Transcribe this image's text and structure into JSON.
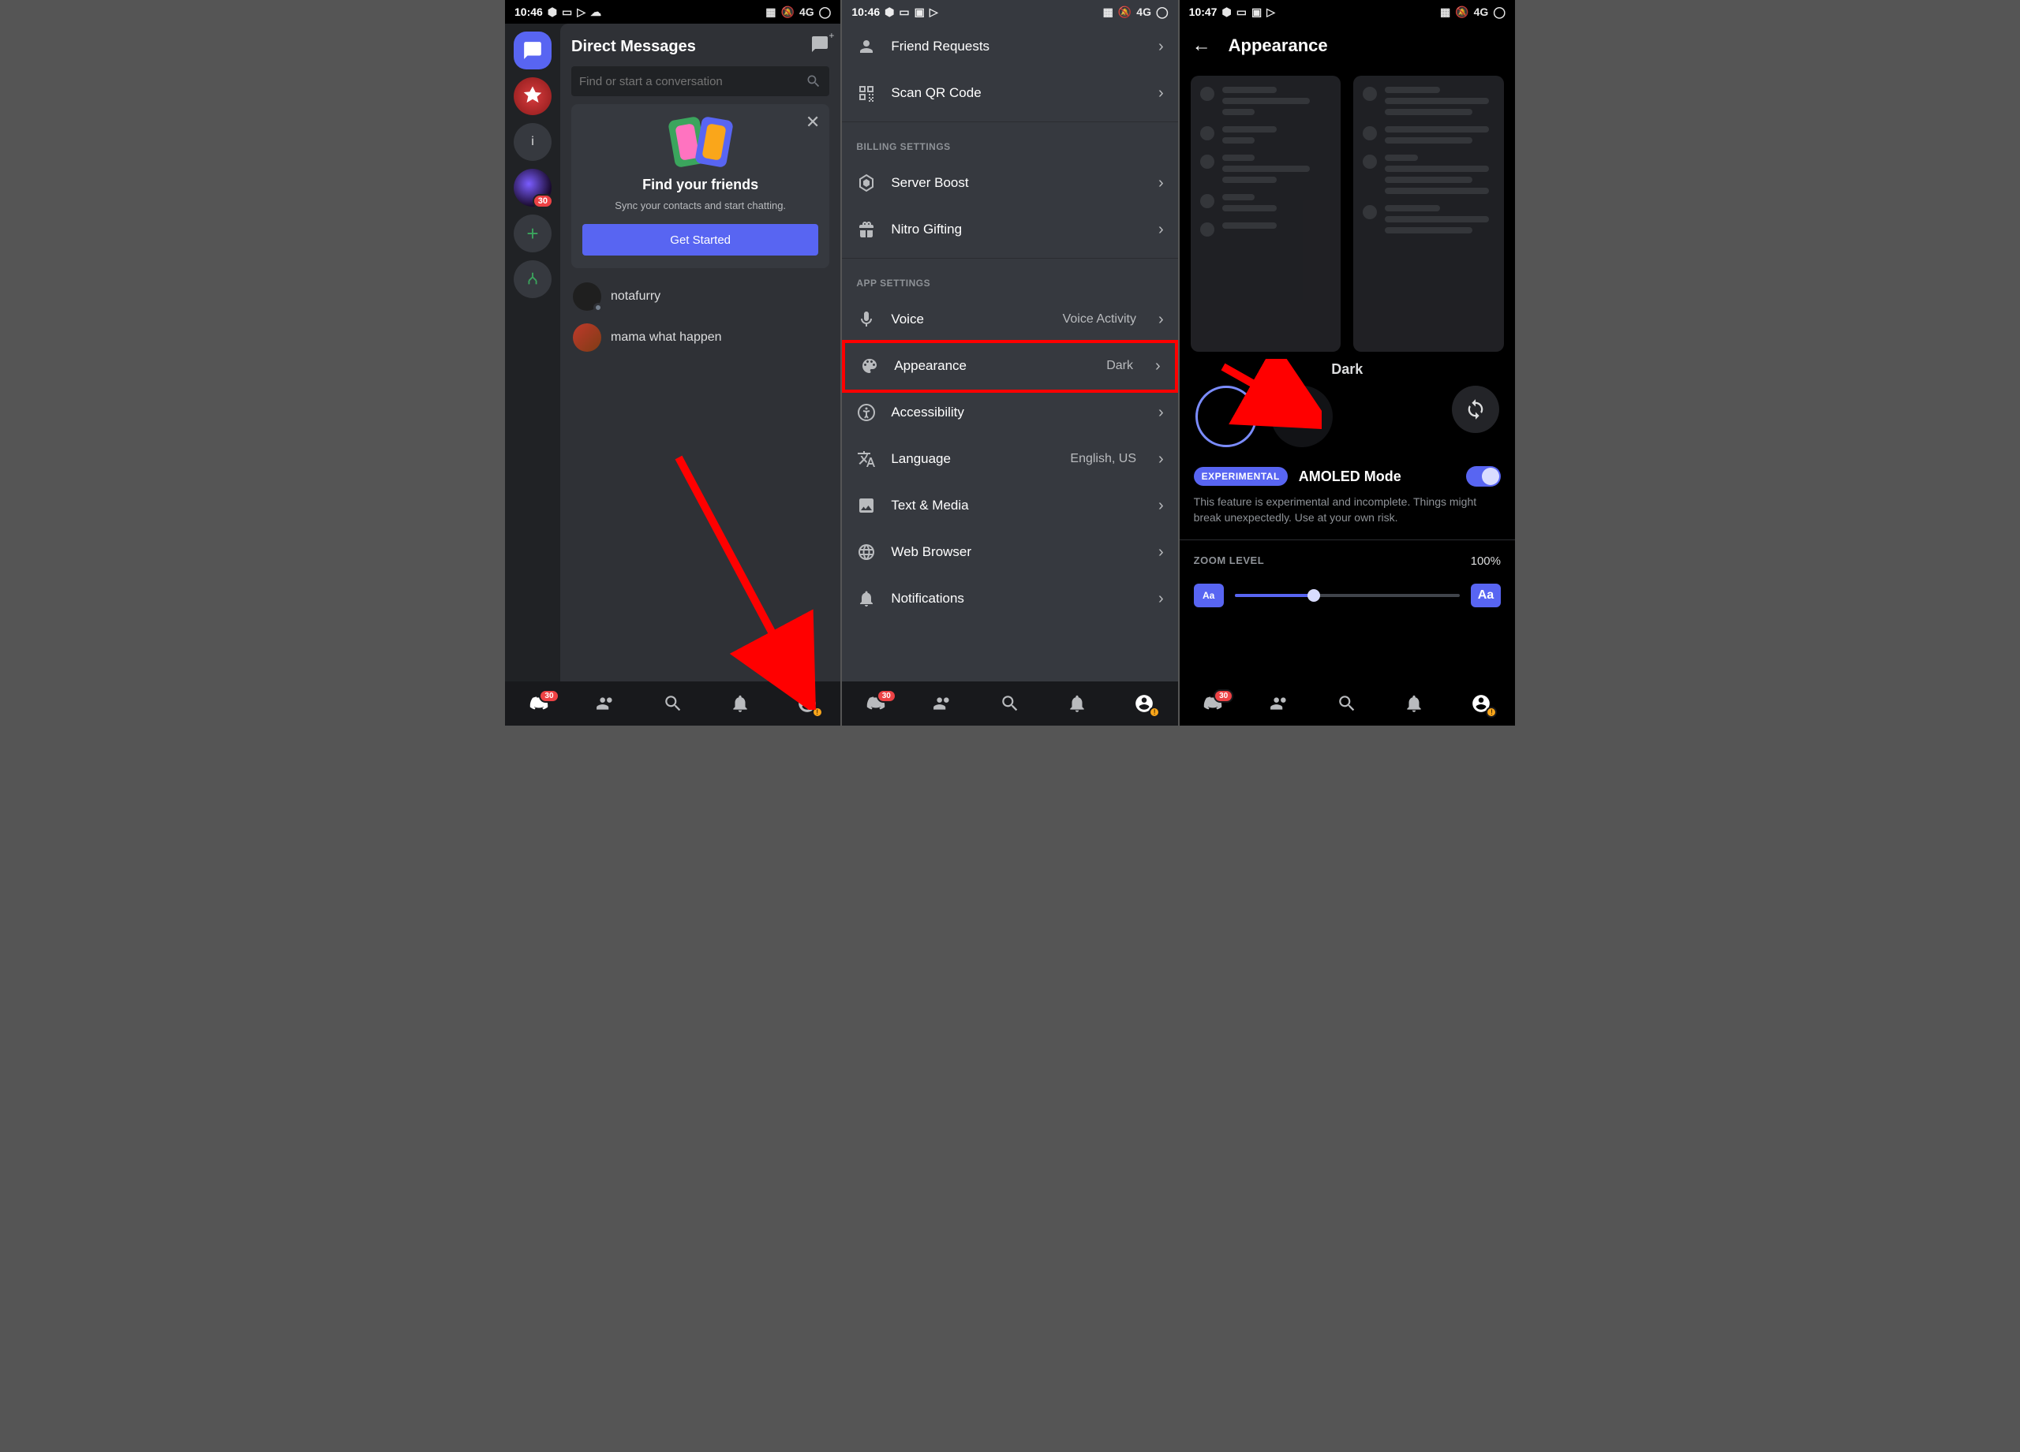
{
  "status": {
    "time1": "10:46",
    "time2": "10:46",
    "time3": "10:47",
    "net": "4G"
  },
  "phone1": {
    "dm_title": "Direct Messages",
    "search_placeholder": "Find or start a conversation",
    "card": {
      "title": "Find your friends",
      "subtitle": "Sync your contacts and start chatting.",
      "button": "Get Started"
    },
    "dms": [
      {
        "name": "notafurry"
      },
      {
        "name": "mama what happen"
      }
    ],
    "badge30": "30"
  },
  "phone2": {
    "rows_top": [
      {
        "label": "Friend Requests"
      },
      {
        "label": "Scan QR Code"
      }
    ],
    "section_billing": "BILLING SETTINGS",
    "rows_billing": [
      {
        "label": "Server Boost"
      },
      {
        "label": "Nitro Gifting"
      }
    ],
    "section_app": "APP SETTINGS",
    "rows_app": [
      {
        "label": "Voice",
        "value": "Voice Activity"
      },
      {
        "label": "Appearance",
        "value": "Dark"
      },
      {
        "label": "Accessibility"
      },
      {
        "label": "Language",
        "value": "English, US"
      },
      {
        "label": "Text & Media"
      },
      {
        "label": "Web Browser"
      },
      {
        "label": "Notifications"
      }
    ],
    "badge30": "30"
  },
  "phone3": {
    "title": "Appearance",
    "theme_label": "Dark",
    "experimental": "EXPERIMENTAL",
    "amoled_label": "AMOLED Mode",
    "amoled_desc": "This feature is experimental and incomplete. Things might break unexpectedly. Use at your own risk.",
    "zoom_label": "ZOOM LEVEL",
    "zoom_value": "100%",
    "aa": "Aa",
    "badge30": "30"
  }
}
